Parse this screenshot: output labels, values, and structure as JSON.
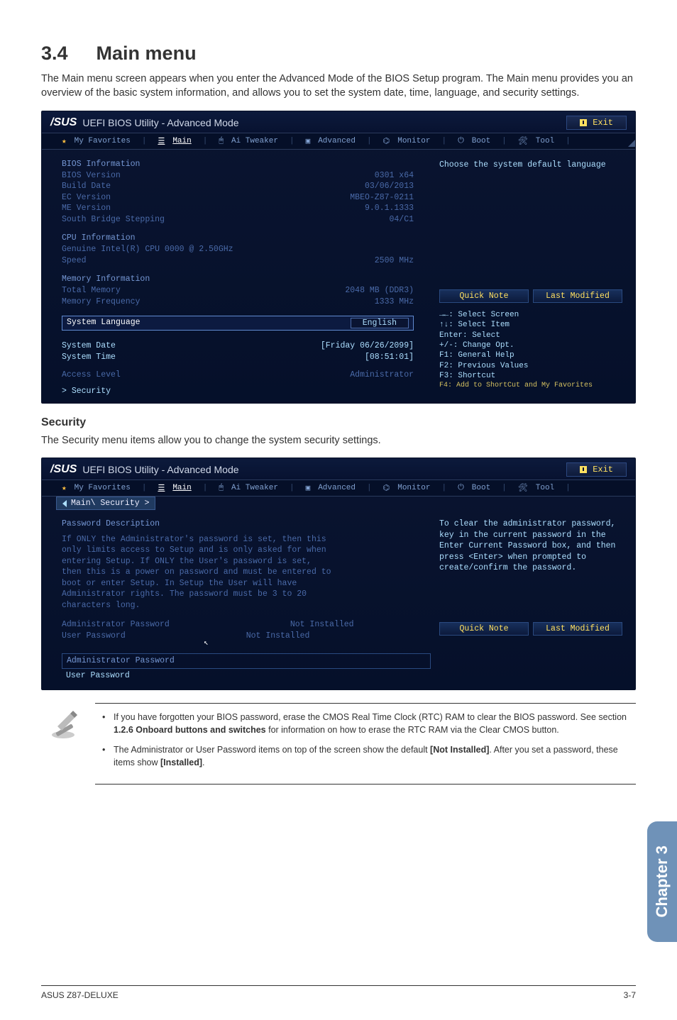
{
  "section_number": "3.4",
  "section_title": "Main menu",
  "intro": "The Main menu screen appears when you enter the Advanced Mode of the BIOS Setup program. The Main menu provides you an overview of the basic system information, and allows you to set the system date, time, language, and security settings.",
  "bios": {
    "brand": "/SUS",
    "title": "UEFI BIOS Utility - Advanced Mode",
    "exit": "Exit",
    "menu": {
      "favorites": "My Favorites",
      "main": "Main",
      "tweaker": "Ai Tweaker",
      "advanced": "Advanced",
      "monitor": "Monitor",
      "boot": "Boot",
      "tool": "Tool"
    },
    "panel1": {
      "help_text": "Choose the system default language",
      "bios_info_head": "BIOS Information",
      "bios_version_l": "BIOS Version",
      "bios_version_v": "0301 x64",
      "build_date_l": "Build Date",
      "build_date_v": "03/06/2013",
      "ec_l": "EC Version",
      "ec_v": "MBEO-Z87-0211",
      "me_l": "ME Version",
      "me_v": "9.0.1.1333",
      "sb_l": "South Bridge Stepping",
      "sb_v": "04/C1",
      "cpu_info_head": "CPU Information",
      "cpu_name": "Genuine Intel(R) CPU 0000 @ 2.50GHz",
      "speed_l": "Speed",
      "speed_v": "2500 MHz",
      "mem_info_head": "Memory Information",
      "total_mem_l": "Total Memory",
      "total_mem_v": "2048 MB (DDR3)",
      "mem_freq_l": "Memory Frequency",
      "mem_freq_v": "1333 MHz",
      "sys_lang_l": "System Language",
      "sys_lang_v": "English",
      "sys_date_l": "System Date",
      "sys_date_v": "[Friday 06/26/2099]",
      "sys_time_l": "System Time",
      "sys_time_v": "[08:51:01]",
      "access_l": "Access Level",
      "access_v": "Administrator",
      "security": "Security",
      "quick_note": "Quick Note",
      "last_modified": "Last Modified",
      "keys": {
        "k1": "→←: Select Screen",
        "k2": "↑↓: Select Item",
        "k3": "Enter: Select",
        "k4": "+/-: Change Opt.",
        "k5": "F1: General Help",
        "k6": "F2: Previous Values",
        "k7": "F3: Shortcut",
        "k8": "F4: Add to ShortCut and My Favorites"
      }
    }
  },
  "security_heading": "Security",
  "security_intro": "The Security menu items allow you to change the system security settings.",
  "bios2": {
    "breadcrumb": "Main\\ Security >",
    "desc_head": "Password Description",
    "desc_body": "If ONLY the Administrator's password is set, then this only limits access to Setup and is only asked for when entering Setup. If ONLY the User's password is set, then this is a power on password and must be entered to boot or enter Setup. In Setup the User will have Administrator rights. The password must be 3 to 20 characters long.",
    "admin_pw_l": "Administrator Password",
    "admin_pw_v": "Not Installed",
    "user_pw_l": "User Password",
    "user_pw_v": "Not Installed",
    "act_admin": "Administrator Password",
    "act_user": "User Password",
    "help_text": "To clear the administrator password, key in the current password in the Enter Current Password box, and then press <Enter> when prompted to create/confirm the password.",
    "quick_note": "Quick Note",
    "last_modified": "Last Modified"
  },
  "notes": {
    "n1a": "If you have forgotten your BIOS password, erase the CMOS Real Time Clock (RTC) RAM to clear the BIOS password. See section ",
    "n1b": "1.2.6 Onboard buttons and switches",
    "n1c": " for information on how to erase the RTC RAM via the Clear CMOS button.",
    "n2a": "The Administrator or User Password items on top of the screen show the default ",
    "n2b": "[Not Installed]",
    "n2c": ". After you set a password, these items show ",
    "n2d": "[Installed]",
    "n2e": "."
  },
  "chapter_tab": "Chapter 3",
  "footer_left": "ASUS Z87-DELUXE",
  "footer_right": "3-7"
}
